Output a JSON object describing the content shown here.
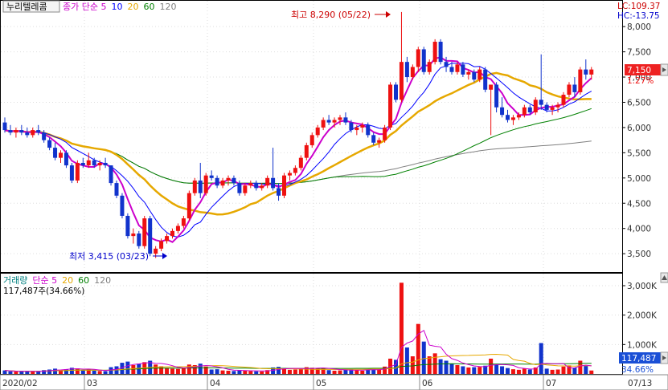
{
  "header": {
    "stock_name": "누리텔레콤",
    "price_legend": [
      {
        "label": "종가 단순 5",
        "color": "#cc00cc"
      },
      {
        "label": "10",
        "color": "#0000ff"
      },
      {
        "label": "20",
        "color": "#e6a800"
      },
      {
        "label": "60",
        "color": "#008000"
      },
      {
        "label": "120",
        "color": "#808080"
      }
    ],
    "volume_legend": [
      {
        "label": "거래량",
        "color": "#008080"
      },
      {
        "label": "단순 5",
        "color": "#cc00cc"
      },
      {
        "label": "20",
        "color": "#e6a800"
      },
      {
        "label": "60",
        "color": "#008000"
      },
      {
        "label": "120",
        "color": "#808080"
      }
    ],
    "volume_info": "117,487주(34.66%)",
    "lc": "LC:109.37",
    "hc": "HC:-13.75"
  },
  "annotations": {
    "high": "최고 8,290 (05/22)",
    "low": "최저 3,415 (03/23)"
  },
  "badges": {
    "last_price": "7,150",
    "last_change": "1.27%",
    "last_volume": "117,487",
    "last_volume_pct": "34.66%"
  },
  "colors": {
    "up": "#ee1111",
    "down": "#1133cc"
  },
  "chart_data": {
    "type": "candlestick",
    "price_axis": {
      "ticks": [
        "8,000",
        "7,500",
        "7,000",
        "6,500",
        "6,000",
        "5,500",
        "5,000",
        "4,500",
        "4,000",
        "3,500"
      ],
      "range": [
        3200,
        8400
      ]
    },
    "volume_axis": {
      "ticks": [
        "3,000K",
        "2,000K",
        "1,000K"
      ],
      "range": [
        0,
        3300
      ]
    },
    "x_ticks": [
      "2020/02",
      "03",
      "04",
      "05",
      "06",
      "07",
      "07/13"
    ],
    "candles": [
      [
        6100,
        6200,
        5900,
        5950,
        120
      ],
      [
        5950,
        6050,
        5850,
        5900,
        90
      ],
      [
        5900,
        6000,
        5800,
        5950,
        80
      ],
      [
        5950,
        6050,
        5850,
        5900,
        85
      ],
      [
        5900,
        6000,
        5800,
        5850,
        95
      ],
      [
        5850,
        6000,
        5800,
        5950,
        90
      ],
      [
        5950,
        6050,
        5850,
        5900,
        85
      ],
      [
        5900,
        5950,
        5700,
        5750,
        130
      ],
      [
        5750,
        5800,
        5550,
        5600,
        150
      ],
      [
        5600,
        5700,
        5350,
        5400,
        180
      ],
      [
        5400,
        5550,
        5300,
        5500,
        140
      ],
      [
        5500,
        5550,
        5200,
        5250,
        160
      ],
      [
        5250,
        5300,
        4900,
        4950,
        210
      ],
      [
        4950,
        5350,
        4900,
        5300,
        190
      ],
      [
        5300,
        5400,
        5200,
        5250,
        120
      ],
      [
        5250,
        5500,
        5200,
        5350,
        150
      ],
      [
        5350,
        5400,
        5200,
        5250,
        110
      ],
      [
        5250,
        5350,
        5150,
        5300,
        100
      ],
      [
        5300,
        5400,
        5200,
        5250,
        95
      ],
      [
        5250,
        5250,
        4850,
        4900,
        230
      ],
      [
        4900,
        4950,
        4600,
        4650,
        260
      ],
      [
        4650,
        4700,
        4200,
        4250,
        380
      ],
      [
        4250,
        4300,
        3800,
        3850,
        420
      ],
      [
        3850,
        4000,
        3700,
        3900,
        300
      ],
      [
        3900,
        3950,
        3600,
        3650,
        350
      ],
      [
        3650,
        4250,
        3600,
        4200,
        400
      ],
      [
        4200,
        4250,
        3450,
        3500,
        450
      ],
      [
        3500,
        3650,
        3415,
        3600,
        320
      ],
      [
        3600,
        3800,
        3550,
        3750,
        260
      ],
      [
        3750,
        3900,
        3700,
        3850,
        200
      ],
      [
        3850,
        4000,
        3800,
        3950,
        180
      ],
      [
        3950,
        4100,
        3900,
        4050,
        170
      ],
      [
        4050,
        4250,
        4000,
        4200,
        210
      ],
      [
        4200,
        4750,
        4150,
        4700,
        320
      ],
      [
        4700,
        5000,
        4650,
        4950,
        300
      ],
      [
        4950,
        5300,
        4600,
        4700,
        350
      ],
      [
        4700,
        5100,
        4650,
        5050,
        250
      ],
      [
        5050,
        5150,
        4950,
        5000,
        150
      ],
      [
        5000,
        5050,
        4800,
        4850,
        160
      ],
      [
        4850,
        5000,
        4800,
        4950,
        120
      ],
      [
        4950,
        5050,
        4850,
        5000,
        110
      ],
      [
        5000,
        5050,
        4850,
        4900,
        100
      ],
      [
        4900,
        4950,
        4650,
        4700,
        130
      ],
      [
        4700,
        4900,
        4650,
        4850,
        110
      ],
      [
        4850,
        4950,
        4800,
        4900,
        95
      ],
      [
        4900,
        4950,
        4750,
        4800,
        90
      ],
      [
        4800,
        4900,
        4750,
        4850,
        85
      ],
      [
        4850,
        5050,
        4800,
        5000,
        130
      ],
      [
        5000,
        5600,
        4750,
        4800,
        220
      ],
      [
        4800,
        4900,
        4550,
        4650,
        240
      ],
      [
        4650,
        5100,
        4600,
        5050,
        200
      ],
      [
        5050,
        5150,
        4950,
        5100,
        140
      ],
      [
        5100,
        5250,
        5050,
        5200,
        150
      ],
      [
        5200,
        5450,
        5150,
        5400,
        190
      ],
      [
        5400,
        5700,
        5350,
        5650,
        230
      ],
      [
        5650,
        5900,
        5600,
        5850,
        210
      ],
      [
        5850,
        6050,
        5800,
        6000,
        200
      ],
      [
        6000,
        6200,
        5950,
        6150,
        190
      ],
      [
        6150,
        6250,
        6050,
        6100,
        130
      ],
      [
        6100,
        6200,
        6000,
        6150,
        110
      ],
      [
        6150,
        6250,
        6050,
        6200,
        120
      ],
      [
        6200,
        6300,
        6050,
        6100,
        140
      ],
      [
        6100,
        6150,
        5900,
        5950,
        160
      ],
      [
        5950,
        6050,
        5850,
        6000,
        130
      ],
      [
        6000,
        6100,
        5900,
        6050,
        110
      ],
      [
        6050,
        6100,
        5800,
        5850,
        150
      ],
      [
        5850,
        5900,
        5650,
        5700,
        170
      ],
      [
        5700,
        5800,
        5600,
        5750,
        160
      ],
      [
        5750,
        6050,
        5700,
        6000,
        250
      ],
      [
        6000,
        6900,
        5950,
        6850,
        520
      ],
      [
        6850,
        6900,
        6500,
        6550,
        480
      ],
      [
        6550,
        8290,
        6500,
        7300,
        3100
      ],
      [
        7300,
        7400,
        6900,
        7000,
        900
      ],
      [
        7000,
        7250,
        6950,
        7200,
        600
      ],
      [
        7200,
        7600,
        7100,
        7550,
        1700
      ],
      [
        7550,
        7600,
        7050,
        7100,
        1100
      ],
      [
        7100,
        7350,
        7050,
        7300,
        600
      ],
      [
        7300,
        7750,
        7250,
        7700,
        700
      ],
      [
        7700,
        7750,
        7250,
        7300,
        500
      ],
      [
        7300,
        7400,
        7100,
        7200,
        450
      ],
      [
        7200,
        7300,
        7050,
        7100,
        350
      ],
      [
        7100,
        7300,
        7050,
        7250,
        300
      ],
      [
        7250,
        7300,
        7000,
        7050,
        260
      ],
      [
        7050,
        7150,
        6950,
        7100,
        220
      ],
      [
        7100,
        7150,
        6900,
        6950,
        230
      ],
      [
        6950,
        7200,
        6900,
        7150,
        240
      ],
      [
        7150,
        7200,
        6700,
        6750,
        280
      ],
      [
        6750,
        6850,
        5850,
        6850,
        520
      ],
      [
        6850,
        6900,
        6300,
        6400,
        300
      ],
      [
        6400,
        6600,
        6200,
        6250,
        260
      ],
      [
        6250,
        6350,
        6100,
        6150,
        200
      ],
      [
        6150,
        6250,
        6050,
        6200,
        160
      ],
      [
        6200,
        6300,
        6150,
        6250,
        140
      ],
      [
        6250,
        6450,
        6200,
        6400,
        180
      ],
      [
        6400,
        6450,
        6250,
        6300,
        150
      ],
      [
        6300,
        6600,
        6250,
        6550,
        220
      ],
      [
        6550,
        7450,
        6350,
        6450,
        1050
      ],
      [
        6450,
        6500,
        6300,
        6350,
        180
      ],
      [
        6350,
        6450,
        6250,
        6400,
        140
      ],
      [
        6400,
        6500,
        6300,
        6450,
        150
      ],
      [
        6450,
        6700,
        6400,
        6650,
        250
      ],
      [
        6650,
        6900,
        6600,
        6850,
        290
      ],
      [
        6850,
        7000,
        6600,
        6700,
        210
      ],
      [
        6700,
        7200,
        6650,
        7150,
        450
      ],
      [
        7150,
        7350,
        6950,
        7050,
        300
      ],
      [
        7050,
        7200,
        6950,
        7150,
        117
      ]
    ]
  }
}
